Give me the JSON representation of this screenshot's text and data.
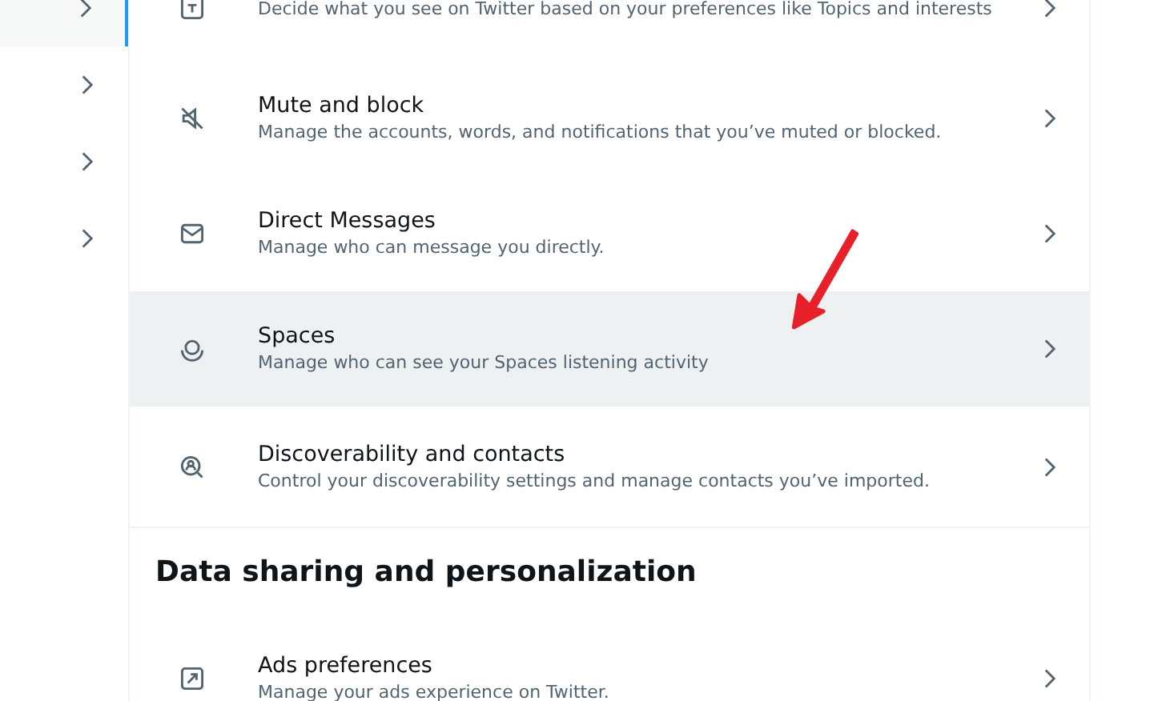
{
  "sidebar": {
    "items": [
      {
        "selected": true
      },
      {
        "selected": false
      },
      {
        "selected": false
      },
      {
        "selected": false
      }
    ]
  },
  "settings": {
    "rows": [
      {
        "kind": "topics",
        "description": "Decide what you see on Twitter based on your preferences like Topics and interests",
        "hovered": false
      },
      {
        "kind": "mute",
        "title": "Mute and block",
        "description": "Manage the accounts, words, and notifications that you’ve muted or blocked.",
        "hovered": false
      },
      {
        "kind": "mail",
        "title": "Direct Messages",
        "description": "Manage who can message you directly.",
        "hovered": false
      },
      {
        "kind": "spaces",
        "title": "Spaces",
        "description": "Manage who can see your Spaces listening activity",
        "hovered": true
      },
      {
        "kind": "discover",
        "title": "Discoverability and contacts",
        "description": "Control your discoverability settings and manage contacts you’ve imported.",
        "hovered": false
      }
    ]
  },
  "section": {
    "title": "Data sharing and personalization",
    "rows": [
      {
        "kind": "ads",
        "title": "Ads preferences",
        "description": "Manage your ads experience on Twitter.",
        "hovered": false
      }
    ]
  }
}
